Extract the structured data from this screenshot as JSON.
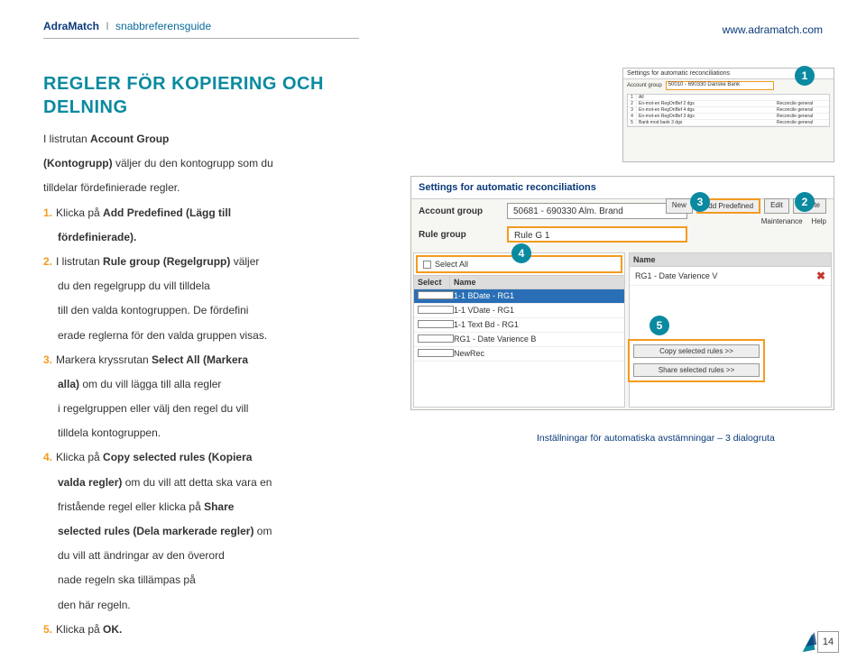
{
  "header": {
    "brand": "AdraMatch",
    "sep": "I",
    "sub": "snabbreferensguide",
    "url": "www.adramatch.com"
  },
  "title": "REGLER FÖR KOPIERING OCH DELNING",
  "intro1": "I listrutan Account Group",
  "intro2": "(Kontogrupp) väljer du den kontogrupp som du",
  "intro3": "tilldelar fördefinierade regler.",
  "steps": {
    "s1a": "Klicka på ",
    "s1b": "Add Predefined (Lägg till",
    "s1c": "fördefinierade).",
    "s2a": "I listrutan ",
    "s2b": "Rule group (Regelgrupp)",
    "s2c": " väljer",
    "s2d": "du den regelgrupp du vill tilldela",
    "s2e": "till den valda kontogruppen. ",
    "s2f": "De fördefini",
    "s2g": "erade reglerna för den valda gruppen visas.",
    "s3a": "Markera kryssrutan ",
    "s3b": "Select All (Markera",
    "s3c": "alla)",
    "s3d": " om du vill lägga till alla regler",
    "s3e": "i regelgruppen eller välj den regel du vill",
    "s3f": "tilldela kontogruppen.",
    "s4a": "Klicka på ",
    "s4b": "Copy selected rules (Kopiera",
    "s4c": "valda regler)",
    "s4d": " om du vill att detta ska vara en",
    "s4e": "fristående regel eller klicka på ",
    "s4f": "Share",
    "s4g": "selected rules (Dela markerade regler)",
    "s4h": " om",
    "s4i": "du vill att ändringar av den överord",
    "s4j": "nade regeln ska tillämpas på",
    "s4k": "den här regeln.",
    "s5a": "Klicka på ",
    "s5b": "OK."
  },
  "mini": {
    "title": "Settings for automatic reconciliations",
    "acct_label": "Account group",
    "acct_val": "50010 - 690330 Danske Bank",
    "rows": [
      {
        "n": "1",
        "name": "All",
        "type": ""
      },
      {
        "n": "2",
        "name": "En-mot-en RegOnBef 2 dgs",
        "type": "Reconcile general"
      },
      {
        "n": "3",
        "name": "En-mot-en RegOnBef 4 dgs",
        "type": "Reconcile general"
      },
      {
        "n": "4",
        "name": "En-mot-en RegOnBef 3 dgs",
        "type": "Reconcile general"
      },
      {
        "n": "5",
        "name": "Bank mod bank 3 dgs",
        "type": "Reconcile general"
      }
    ]
  },
  "big": {
    "title": "Settings for automatic reconciliations",
    "acct_label": "Account group",
    "acct_val": "50681 - 690330 Alm. Brand",
    "rule_label": "Rule group",
    "rule_val": "Rule G 1",
    "btn_new": "New",
    "btn_add": "Add Predefined",
    "btn_edit": "Edit",
    "btn_del": "Delete",
    "maint": "Maintenance",
    "help": "Help",
    "selall": "Select All",
    "col_select": "Select",
    "col_name": "Name",
    "rows_left": [
      "1-1 BDate - RG1",
      "1-1 VDate - RG1",
      "1-1 Text Bd - RG1",
      "RG1 - Date Varience B",
      "NewRec"
    ],
    "col_name2": "Name",
    "row_right": "RG1 - Date Varience V",
    "copy_btn": "Copy selected rules >>",
    "share_btn": "Share selected rules >>"
  },
  "bubbles": {
    "b1": "1",
    "b2": "2",
    "b3": "3",
    "b4": "4",
    "b5": "5"
  },
  "caption": "Inställningar för automatiska avstämningar – 3 dialogruta",
  "pagenum": "14"
}
